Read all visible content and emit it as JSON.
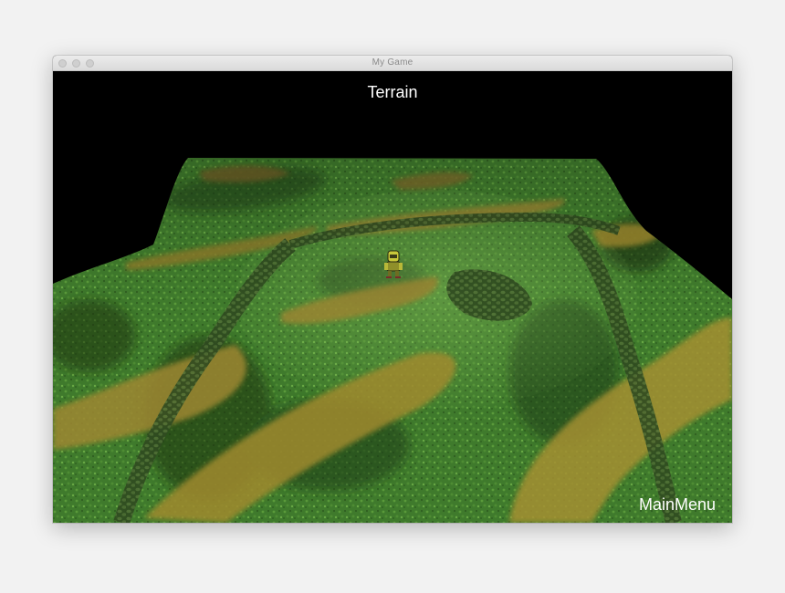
{
  "window": {
    "title": "My Game"
  },
  "hud": {
    "scene_title": "Terrain",
    "main_menu_label": "MainMenu"
  },
  "scene": {
    "background_color": "#000000",
    "grass_color": "#3f7a2c",
    "dirt_color": "#a08a2e",
    "cobble_color": "#3e5a2a",
    "character_color": "#c8c83a"
  }
}
